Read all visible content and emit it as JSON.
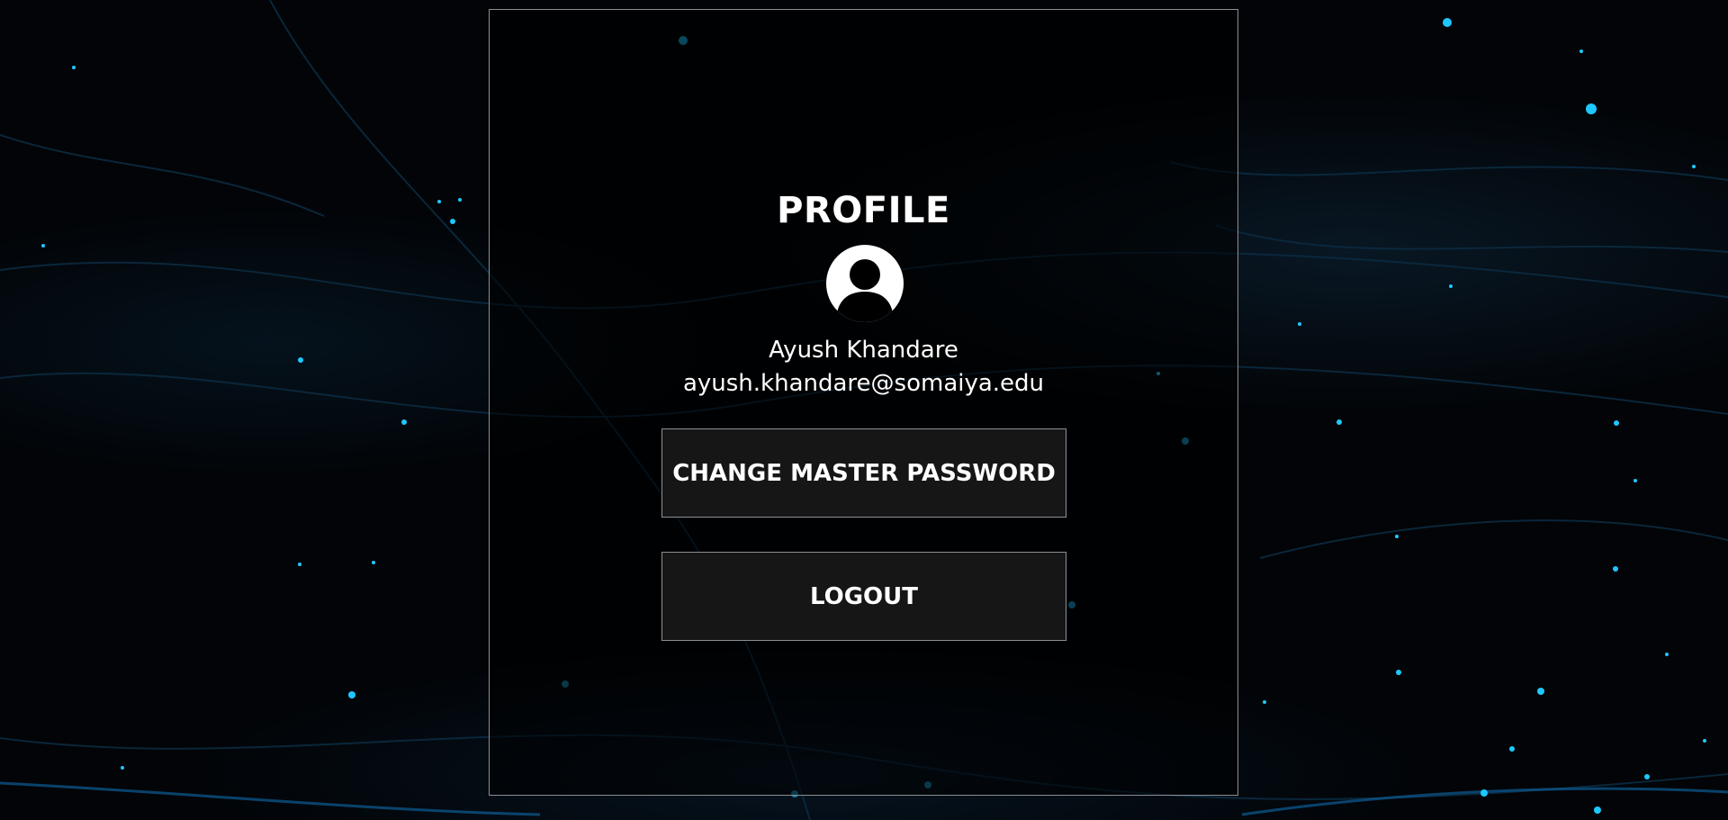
{
  "profile": {
    "title": "PROFILE",
    "name": "Ayush Khandare",
    "email": "ayush.khandare@somaiya.edu"
  },
  "buttons": {
    "change_password_label": "CHANGE MASTER PASSWORD",
    "logout_label": "LOGOUT"
  },
  "icons": {
    "avatar": "user-avatar-icon"
  },
  "colors": {
    "background": "#000000",
    "text": "#ffffff",
    "button_bg": "#161616",
    "border": "#8a8f94",
    "accent_particles": "#1ec8ff"
  }
}
